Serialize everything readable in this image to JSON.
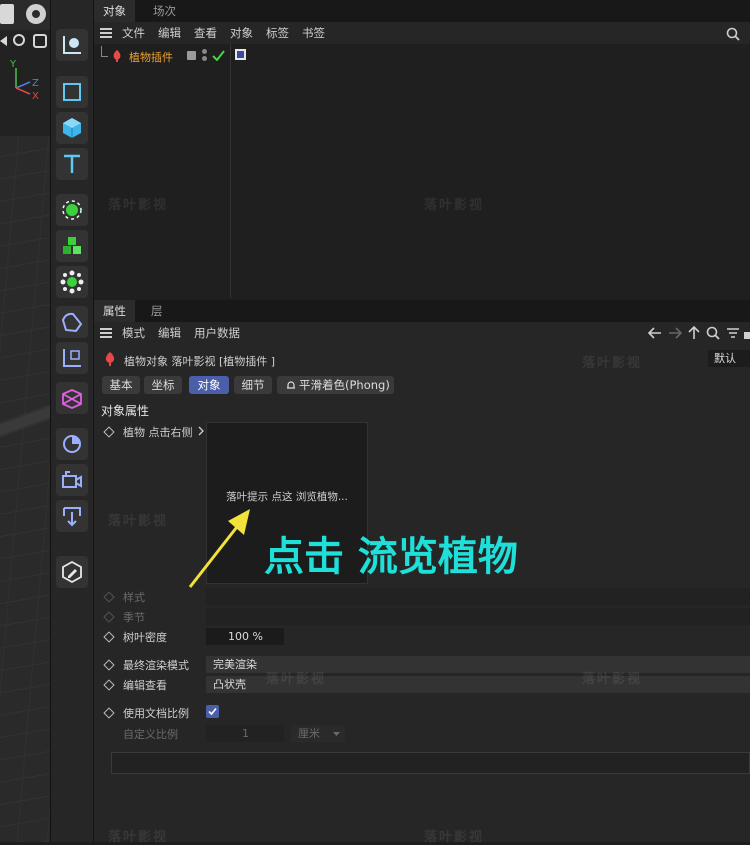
{
  "object_manager": {
    "tabs": [
      "对象",
      "场次"
    ],
    "menu": [
      "文件",
      "编辑",
      "查看",
      "对象",
      "标签",
      "书签"
    ],
    "object_row": {
      "name": "植物插件"
    }
  },
  "attribute_manager": {
    "tabs": [
      "属性",
      "层"
    ],
    "menu": [
      "模式",
      "编辑",
      "用户数据"
    ],
    "header": {
      "object_line": "植物对象  落叶影视 [植物插件 ]",
      "mode_select": "默认"
    },
    "subtabs": [
      "基本",
      "坐标",
      "对象",
      "细节",
      "平滑着色(Phong)"
    ],
    "section_title": "对象属性",
    "plant_label": "植物 点击右侧",
    "preview_hint": "落叶提示 点这 浏览植物...",
    "annotation": "点击 流览植物",
    "rows": {
      "style_label": "样式",
      "season_label": "季节",
      "density_label": "树叶密度",
      "density_value": "100 %",
      "render_mode_label": "最终渲染模式",
      "render_mode_value": "完美渲染",
      "editor_view_label": "编辑查看",
      "editor_view_value": "凸状壳",
      "doc_scale_label": "使用文档比例",
      "doc_scale_checked": true,
      "custom_scale_label": "自定义比例",
      "custom_scale_value": "1",
      "unit_value": "厘米"
    }
  },
  "viewport": {
    "axis_y": "Y",
    "axis_z": "Z",
    "axis_x": "X"
  },
  "watermark": "落叶影视",
  "colors": {
    "accent": "#4b5fa8",
    "annotation": "#1ee0d8",
    "arrow": "#f2e23a",
    "object_name": "#f0a030",
    "check": "#4ad24a"
  }
}
